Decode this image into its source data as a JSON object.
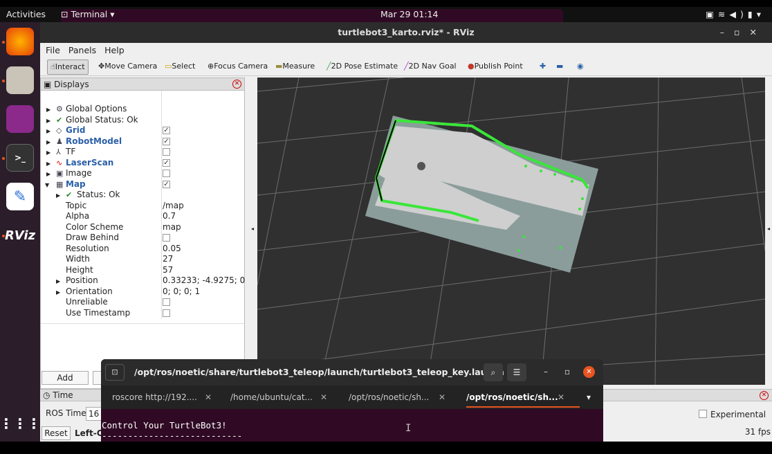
{
  "system": {
    "activities": "Activities",
    "app_menu": "Terminal ▾",
    "clock": "Mar 29  01:14"
  },
  "window": {
    "title": "turtlebot3_karto.rviz* - RViz"
  },
  "menu": [
    "File",
    "Panels",
    "Help"
  ],
  "toolbar": [
    "Interact",
    "Move Camera",
    "Select",
    "Focus Camera",
    "Measure",
    "2D Pose Estimate",
    "2D Nav Goal",
    "Publish Point"
  ],
  "displays": {
    "title": "Displays",
    "items": [
      {
        "label": "Global Options"
      },
      {
        "label": "Global Status: Ok"
      },
      {
        "label": "Grid",
        "checked": true
      },
      {
        "label": "RobotModel",
        "checked": true
      },
      {
        "label": "TF",
        "checked": false
      },
      {
        "label": "LaserScan",
        "checked": true
      },
      {
        "label": "Image",
        "checked": false
      },
      {
        "label": "Map",
        "checked": true
      },
      {
        "label": "Status: Ok"
      },
      {
        "label": "Topic",
        "value": "/map"
      },
      {
        "label": "Alpha",
        "value": "0.7"
      },
      {
        "label": "Color Scheme",
        "value": "map"
      },
      {
        "label": "Draw Behind",
        "checked": false
      },
      {
        "label": "Resolution",
        "value": "0.05"
      },
      {
        "label": "Width",
        "value": "27"
      },
      {
        "label": "Height",
        "value": "57"
      },
      {
        "label": "Position",
        "value": "0.33233; -4.9275; 0"
      },
      {
        "label": "Orientation",
        "value": "0; 0; 0; 1"
      },
      {
        "label": "Unreliable",
        "checked": false
      },
      {
        "label": "Use Timestamp",
        "checked": false
      }
    ],
    "add_label": "Add"
  },
  "time": {
    "title": "Time",
    "ros_time_label": "ROS Time:",
    "ros_time_value": "16",
    "reset_label": "Reset",
    "left_label": "Left-C",
    "experimental_label": "Experimental",
    "fps": "31 fps"
  },
  "terminal": {
    "title": "/opt/ros/noetic/share/turtlebot3_teleop/launch/turtlebot3_teleop_key.launch ht...",
    "tabs": [
      "roscore http://192....",
      "/home/ubuntu/cat...",
      "/opt/ros/noetic/sh...",
      "/opt/ros/noetic/sh..."
    ],
    "lines": [
      "Control Your TurtleBot3!",
      "---------------------------"
    ]
  }
}
